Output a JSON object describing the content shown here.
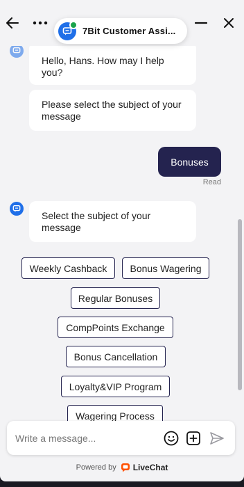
{
  "header": {
    "title": "7Bit Customer Assi...",
    "back_icon": "arrow-left-icon",
    "more_icon": "more-horizontal-icon",
    "minimize_icon": "minimize-icon",
    "close_icon": "close-icon"
  },
  "messages": [
    {
      "from": "bot",
      "text": "Hello, Hans. How may I help you?"
    },
    {
      "from": "bot",
      "text": "Please select the subject of your message"
    },
    {
      "from": "user",
      "text": "Bonuses",
      "status": "Read"
    },
    {
      "from": "bot",
      "text": "Select the subject of your message"
    }
  ],
  "quick_replies": [
    "Weekly Cashback",
    "Bonus Wagering",
    "Regular Bonuses",
    "CompPoints Exchange",
    "Bonus Cancellation",
    "Loyalty&VIP Program",
    "Wagering Process"
  ],
  "composer": {
    "placeholder": "Write a message...",
    "emoji_icon": "emoji-icon",
    "attach_icon": "add-attachment-icon",
    "send_icon": "send-icon"
  },
  "footer": {
    "powered_by": "Powered by",
    "brand": "LiveChat"
  },
  "colors": {
    "accent": "#24234f",
    "agent_blue": "#1f6fe8",
    "online": "#1aa34a",
    "brand_orange": "#ff5100",
    "background": "#f3f3f5"
  }
}
